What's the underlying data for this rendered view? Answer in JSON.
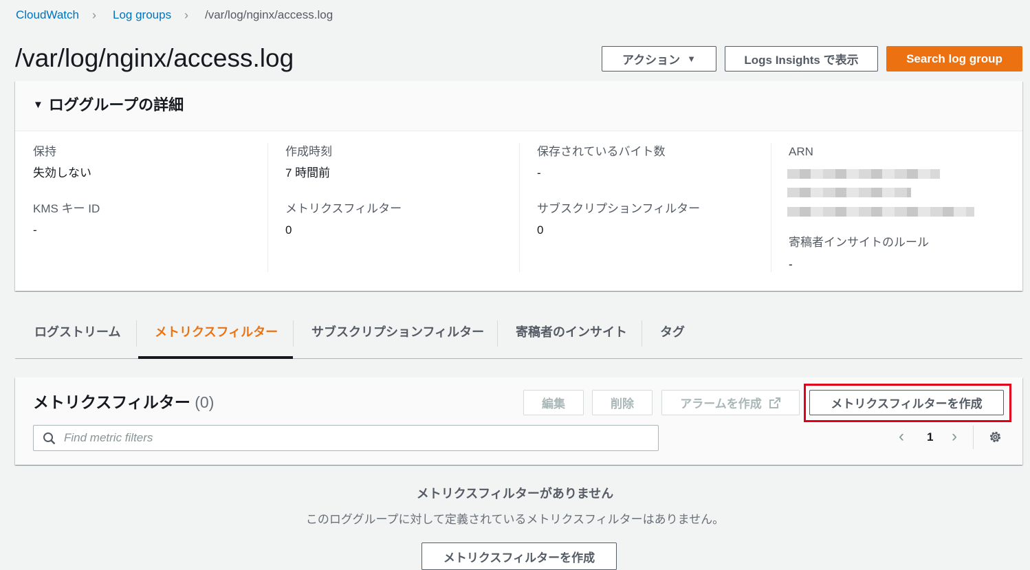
{
  "breadcrumb": {
    "items": [
      "CloudWatch",
      "Log groups"
    ],
    "current": "/var/log/nginx/access.log"
  },
  "header": {
    "title": "/var/log/nginx/access.log",
    "actions_label": "アクション",
    "insights_label": "Logs Insights で表示",
    "search_label": "Search log group"
  },
  "details": {
    "title": "ロググループの詳細",
    "retention_label": "保持",
    "retention_value": "失効しない",
    "kms_label": "KMS キー ID",
    "kms_value": "-",
    "created_label": "作成時刻",
    "created_value": "7 時間前",
    "metric_filters_label": "メトリクスフィルター",
    "metric_filters_value": "0",
    "stored_bytes_label": "保存されているバイト数",
    "stored_bytes_value": "-",
    "subscription_label": "サブスクリプションフィルター",
    "subscription_value": "0",
    "arn_label": "ARN",
    "contributor_label": "寄稿者インサイトのルール",
    "contributor_value": "-"
  },
  "tabs": [
    {
      "label": "ログストリーム"
    },
    {
      "label": "メトリクスフィルター"
    },
    {
      "label": "サブスクリプションフィルター"
    },
    {
      "label": "寄稿者のインサイト"
    },
    {
      "label": "タグ"
    }
  ],
  "metric_filters": {
    "title": "メトリクスフィルター",
    "count": "(0)",
    "edit_label": "編集",
    "delete_label": "削除",
    "alarm_label": "アラームを作成",
    "create_label": "メトリクスフィルターを作成",
    "search_placeholder": "Find metric filters",
    "page_number": "1"
  },
  "empty_state": {
    "title": "メトリクスフィルターがありません",
    "description": "このロググループに対して定義されているメトリクスフィルターはありません。",
    "create_label": "メトリクスフィルターを作成"
  },
  "colors": {
    "accent": "#ec7211",
    "link": "#0073bb",
    "highlight": "#e0001b"
  }
}
